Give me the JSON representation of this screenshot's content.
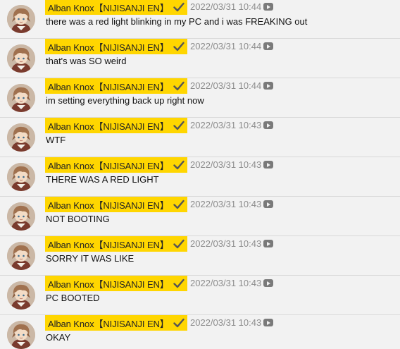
{
  "colors": {
    "background": "#f2f2f2",
    "badge": "#ffd600",
    "timestamp": "#8c8c8c",
    "divider": "#d9d9d9"
  },
  "icons": {
    "avatar": "avatar-icon",
    "verified": "checkmark-icon",
    "video": "play-icon"
  },
  "messages": [
    {
      "author": "Alban Knox【NIJISANJI EN】",
      "timestamp": "2022/03/31 10:44",
      "text": "there was a red light blinking in my PC and i was FREAKING out"
    },
    {
      "author": "Alban Knox【NIJISANJI EN】",
      "timestamp": "2022/03/31 10:44",
      "text": "that's was SO weird"
    },
    {
      "author": "Alban Knox【NIJISANJI EN】",
      "timestamp": "2022/03/31 10:44",
      "text": "im setting everything back up right now"
    },
    {
      "author": "Alban Knox【NIJISANJI EN】",
      "timestamp": "2022/03/31 10:43",
      "text": "WTF"
    },
    {
      "author": "Alban Knox【NIJISANJI EN】",
      "timestamp": "2022/03/31 10:43",
      "text": "THERE WAS A RED LIGHT"
    },
    {
      "author": "Alban Knox【NIJISANJI EN】",
      "timestamp": "2022/03/31 10:43",
      "text": "NOT BOOTING"
    },
    {
      "author": "Alban Knox【NIJISANJI EN】",
      "timestamp": "2022/03/31 10:43",
      "text": "SORRY IT WAS LIKE"
    },
    {
      "author": "Alban Knox【NIJISANJI EN】",
      "timestamp": "2022/03/31 10:43",
      "text": "PC BOOTED"
    },
    {
      "author": "Alban Knox【NIJISANJI EN】",
      "timestamp": "2022/03/31 10:43",
      "text": "OKAY"
    }
  ]
}
